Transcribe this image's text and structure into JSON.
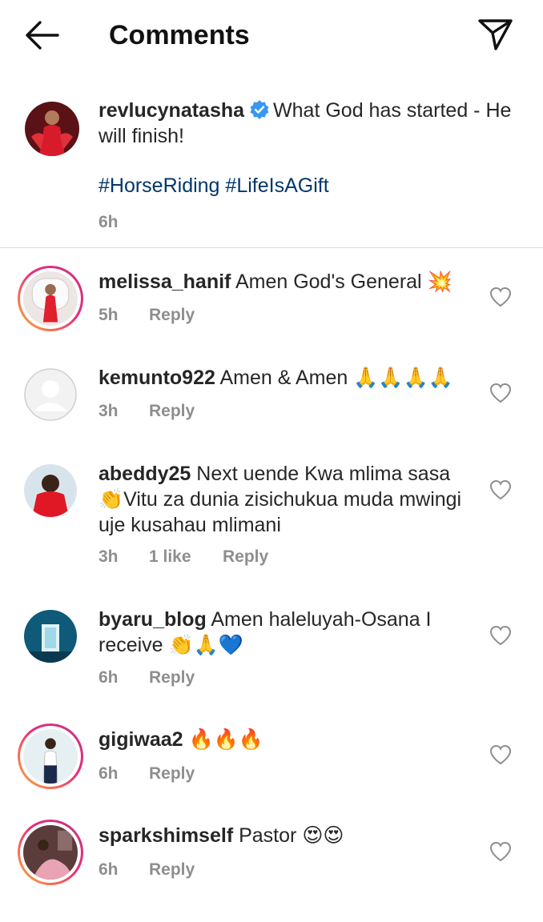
{
  "header": {
    "title": "Comments"
  },
  "post": {
    "username": "revlucynatasha",
    "caption": "What God has started - He will finish!",
    "hashtags": "#HorseRiding #LifeIsAGift",
    "time": "6h"
  },
  "comments": [
    {
      "username": "melissa_hanif",
      "text": "Amen God's General",
      "emoji": "💥",
      "time": "5h",
      "likes": "",
      "reply": "Reply"
    },
    {
      "username": "kemunto922",
      "text": "Amen & Amen",
      "emoji": "🙏🙏🙏🙏",
      "time": "3h",
      "likes": "",
      "reply": "Reply"
    },
    {
      "username": "abeddy25",
      "text": "Next uende Kwa mlima sasa👏Vitu za dunia zisichukua muda mwingi uje kusahau mlimani",
      "emoji": "",
      "time": "3h",
      "likes": "1 like",
      "reply": "Reply"
    },
    {
      "username": "byaru_blog",
      "text": "Amen haleluyah-Osana I receive",
      "emoji": "👏🙏💙",
      "time": "6h",
      "likes": "",
      "reply": "Reply"
    },
    {
      "username": "gigiwaa2",
      "text": "",
      "emoji": "🔥🔥🔥",
      "time": "6h",
      "likes": "",
      "reply": "Reply"
    },
    {
      "username": "sparkshimself",
      "text": "Pastor",
      "emoji": "😍😍",
      "time": "6h",
      "likes": "",
      "reply": "Reply"
    }
  ],
  "colors": {
    "text": "#262626",
    "secondary": "#8e8e8e",
    "hashtag": "#00376b",
    "verified": "#3897f0",
    "story_ring_start": "#f9b233",
    "story_ring_end": "#c13584"
  }
}
